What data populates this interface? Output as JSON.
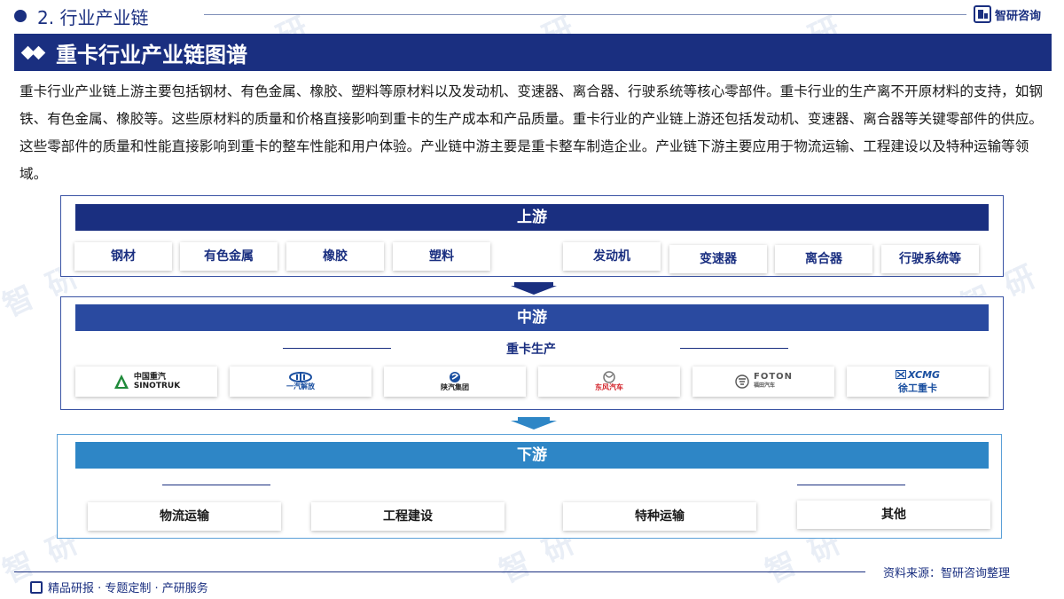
{
  "header": {
    "section_title": "2. 行业产业链",
    "brand": "智研咨询"
  },
  "title": "重卡行业产业链图谱",
  "intro": "重卡行业产业链上游主要包括钢材、有色金属、橡胶、塑料等原材料以及发动机、变速器、离合器、行驶系统等核心零部件。重卡行业的生产离不开原材料的支持，如钢铁、有色金属、橡胶等。这些原材料的质量和价格直接影响到重卡的生产成本和产品质量。重卡行业的产业链上游还包括发动机、变速器、离合器等关键零部件的供应。这些零部件的质量和性能直接影响到重卡的整车性能和用户体验。产业链中游主要是重卡整车制造企业。产业链下游主要应用于物流运输、工程建设以及特种运输等领域。",
  "upstream": {
    "label": "上游",
    "raw_materials": [
      "钢材",
      "有色金属",
      "橡胶",
      "塑料"
    ],
    "components": [
      "发动机",
      "变速器",
      "离合器",
      "行驶系统等"
    ]
  },
  "midstream": {
    "label": "中游",
    "sub_label": "重卡生产",
    "companies": [
      {
        "name": "中国重汽",
        "sub": "SINOTRUK",
        "color": "#1f8a3a",
        "icon": "sinotruk-logo-icon"
      },
      {
        "name": "一汽解放",
        "sub": "",
        "color": "#1a4fa0",
        "icon": "faw-logo-icon"
      },
      {
        "name": "陕汽集团",
        "sub": "",
        "color": "#1a4fa0",
        "icon": "shacman-logo-icon"
      },
      {
        "name": "东风汽车",
        "sub": "",
        "color": "#d2232a",
        "icon": "dongfeng-logo-icon"
      },
      {
        "name": "FOTON",
        "sub": "福田汽车",
        "color": "#555555",
        "icon": "foton-logo-icon"
      },
      {
        "name": "XCMG",
        "sub": "徐工重卡",
        "color": "#1a4fa0",
        "icon": "xcmg-logo-icon"
      }
    ]
  },
  "downstream": {
    "label": "下游",
    "items": [
      "物流运输",
      "工程建设",
      "特种运输",
      "其他"
    ]
  },
  "footer": {
    "source": "资料来源：智研咨询整理",
    "tagline": "精品研报 · 专题定制 · 产研服务"
  },
  "colors": {
    "primary": "#1a2f80",
    "downstream": "#2e86c6"
  }
}
